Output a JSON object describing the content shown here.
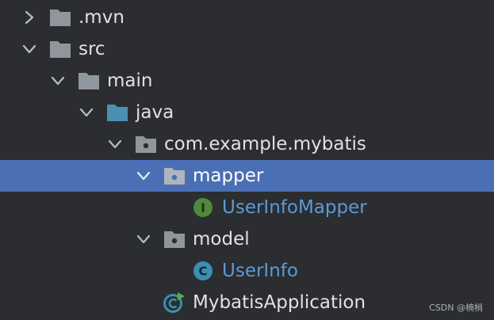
{
  "tree": {
    "items": [
      {
        "label": ".mvn",
        "expanded": false,
        "icon": "folder-icon"
      },
      {
        "label": "src",
        "expanded": true,
        "icon": "folder-icon"
      },
      {
        "label": "main",
        "expanded": true,
        "icon": "folder-icon"
      },
      {
        "label": "java",
        "expanded": true,
        "icon": "source-folder-icon"
      },
      {
        "label": "com.example.mybatis",
        "expanded": true,
        "icon": "package-icon"
      },
      {
        "label": "mapper",
        "expanded": true,
        "icon": "package-icon",
        "selected": true
      },
      {
        "label": "UserInfoMapper",
        "icon": "interface-icon",
        "icon_letter": "I"
      },
      {
        "label": "model",
        "expanded": true,
        "icon": "package-icon"
      },
      {
        "label": "UserInfo",
        "icon": "class-icon",
        "icon_letter": "C"
      },
      {
        "label": "MybatisApplication",
        "icon": "spring-boot-class-icon"
      }
    ]
  },
  "watermark": "CSDN @楠梢",
  "colors": {
    "background": "#2b2d30",
    "selection": "#4a6fb5",
    "folder": "#8f969d",
    "source_folder": "#4d8fb3",
    "interface_badge": "#4f8a3b",
    "class_badge": "#3d8fb0",
    "java_class_text": "#5b9bd5"
  }
}
